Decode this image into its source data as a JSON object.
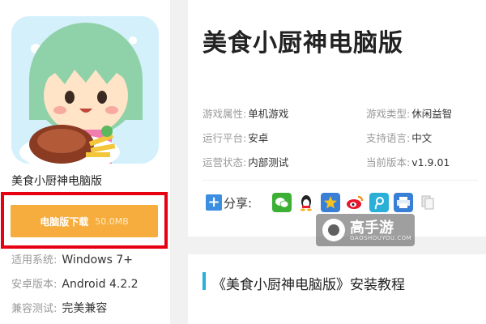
{
  "app": {
    "name": "美食小厨神电脑版",
    "download": {
      "label": "电脑版下载",
      "size": "50.0MB"
    },
    "info": [
      {
        "key": "适用系统:",
        "value": "Windows 7+"
      },
      {
        "key": "安卓版本:",
        "value": "Android 4.2.2"
      },
      {
        "key": "兼容测试:",
        "value": "完美兼容"
      }
    ]
  },
  "main": {
    "title": "美食小厨神电脑版",
    "attributes": [
      {
        "key": "游戏属性:",
        "value": "单机游戏"
      },
      {
        "key": "游戏类型:",
        "value": "休闲益智"
      },
      {
        "key": "运行平台:",
        "value": "安卓"
      },
      {
        "key": "支持语言:",
        "value": "中文"
      },
      {
        "key": "运营状态:",
        "value": "内部测试"
      },
      {
        "key": "当前版本:",
        "value": "v1.9.01"
      }
    ],
    "share": {
      "label": "分享:",
      "icons": [
        "wechat-icon",
        "qq-icon",
        "qzone-icon",
        "weibo-icon",
        "tencent-weibo-icon",
        "print-icon",
        "copy-icon"
      ]
    }
  },
  "watermark": {
    "name": "高手游",
    "domain": "GAOSHOUYOU.COM"
  },
  "tutorial": {
    "title": "《美食小厨神电脑版》安装教程"
  },
  "colors": {
    "download": "#f6ad3d",
    "highlight_border": "#e60012",
    "accent_bar": "#2ab0d8"
  }
}
